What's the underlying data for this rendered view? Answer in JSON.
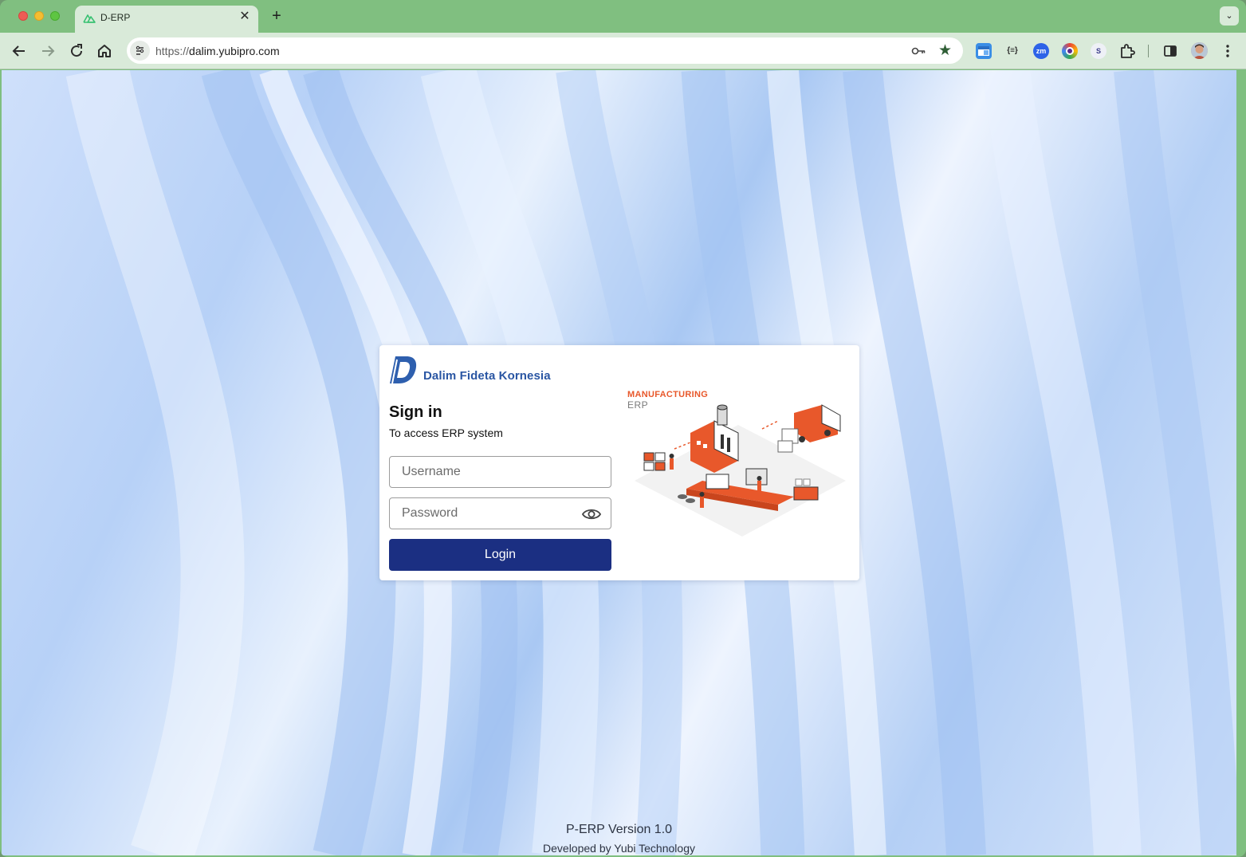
{
  "browser": {
    "tab_title": "D-ERP",
    "tab_close": "✕",
    "new_tab": "+",
    "tab_menu": "⌄",
    "url_scheme": "https://",
    "url_host": "dalim.yubipro.com",
    "extensions": [
      {
        "icon": "window-extension-icon",
        "color": "#3a8ee6"
      },
      {
        "icon": "json-extension-icon",
        "label": "{≡}",
        "color": "#d9ead9"
      },
      {
        "icon": "zoom-extension-icon",
        "label": "zm",
        "color": "#2d63e8"
      },
      {
        "icon": "color-extension-icon",
        "color": "#ea4d7b"
      },
      {
        "icon": "seo-extension-icon",
        "label": "S",
        "color": "#3b3b8a"
      }
    ]
  },
  "login": {
    "company_name": "Dalim Fideta Kornesia",
    "title": "Sign in",
    "subtitle": "To access ERP system",
    "username_placeholder": "Username",
    "password_placeholder": "Password",
    "login_label": "Login",
    "illustration_title": "MANUFACTURING",
    "illustration_subtitle": "ERP"
  },
  "footer": {
    "version": "P-ERP Version 1.0",
    "developer": "Developed by Yubi Technology"
  },
  "colors": {
    "brand": "#2a56a3",
    "primary_button": "#1b2f82",
    "accent_orange": "#e8582b",
    "browser_frame": "#80bf80"
  }
}
